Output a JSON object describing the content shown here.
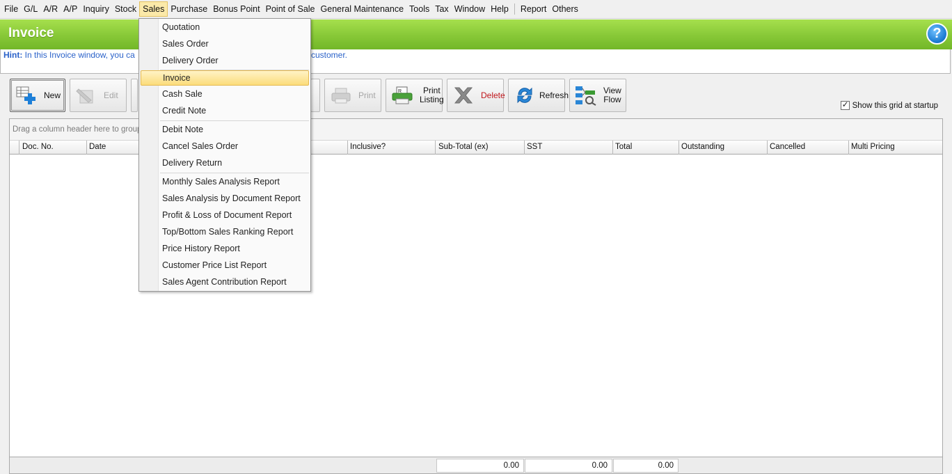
{
  "menubar": {
    "items": [
      "File",
      "G/L",
      "A/R",
      "A/P",
      "Inquiry",
      "Stock",
      "Sales",
      "Purchase",
      "Bonus Point",
      "Point of Sale",
      "General Maintenance",
      "Tools",
      "Tax",
      "Window",
      "Help",
      "Report",
      "Others"
    ],
    "active": "Sales"
  },
  "window": {
    "title": "Invoice"
  },
  "hint": {
    "label": "Hint:",
    "text_before": "In this Invoice window, you ca",
    "text_after": "customer."
  },
  "toolbar": {
    "new": "New",
    "edit": "Edit",
    "print": "Print",
    "print_listing_1": "Print",
    "print_listing_2": "Listing",
    "delete": "Delete",
    "refresh": "Refresh",
    "view_flow_1": "View",
    "view_flow_2": "Flow",
    "startup_label": "Show this grid at startup",
    "startup_checked": true
  },
  "grid": {
    "group_hint": "Drag a column header here to group b",
    "columns": [
      "Doc. No.",
      "Date",
      "Inclusive?",
      "Sub-Total (ex)",
      "SST",
      "Total",
      "Outstanding",
      "Cancelled",
      "Multi Pricing"
    ],
    "footer": {
      "subtotal": "0.00",
      "sst": "0.00",
      "total": "0.00"
    }
  },
  "dropdown": {
    "items": [
      "Quotation",
      "Sales Order",
      "Delivery Order",
      "Invoice",
      "Cash Sale",
      "Credit Note",
      "Debit Note",
      "Cancel Sales Order",
      "Delivery Return",
      "Monthly Sales Analysis Report",
      "Sales Analysis by Document Report",
      "Profit & Loss of Document Report",
      "Top/Bottom Sales Ranking Report",
      "Price History Report",
      "Customer Price List Report",
      "Sales Agent Contribution Report"
    ],
    "highlighted": "Invoice"
  },
  "colors": {
    "banner": "#87c837",
    "hint_text": "#2b62c9",
    "delete_text": "#c0161b",
    "menu_highlight": "#fbdc7b"
  }
}
